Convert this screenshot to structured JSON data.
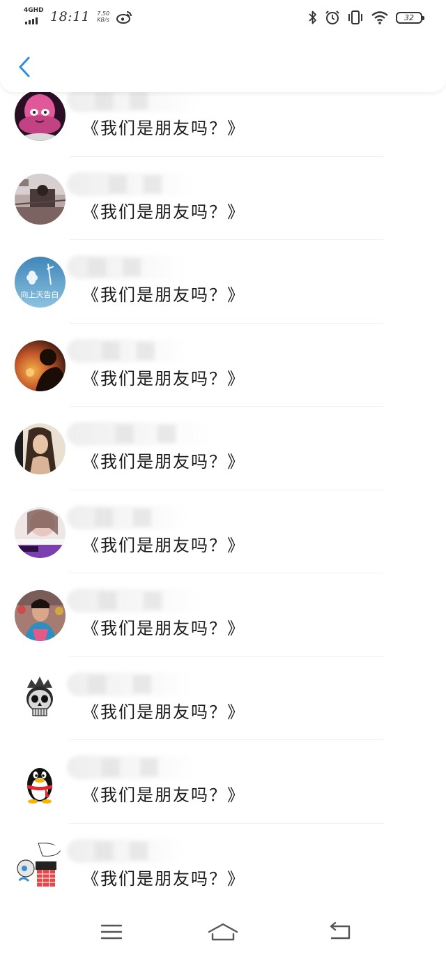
{
  "status_bar": {
    "network": "4GHD",
    "time": "18:11",
    "speed_value": "7.50",
    "speed_unit": "KB/s",
    "battery": "32",
    "icons": [
      "weibo-icon",
      "bluetooth-icon",
      "alarm-icon",
      "vibrate-icon",
      "wifi-icon",
      "battery-icon"
    ]
  },
  "header": {
    "back_icon": "chevron-left-icon",
    "accent_color": "#2f8fde"
  },
  "items": [
    {
      "title": "《我们是朋友吗？》",
      "avatar": "pink-alien-avatar"
    },
    {
      "title": "《我们是朋友吗？》",
      "avatar": "room-photo-avatar"
    },
    {
      "title": "《我们是朋友吗？》",
      "avatar": "blue-sky-avatar",
      "avatar_caption": "向上天告白"
    },
    {
      "title": "《我们是朋友吗？》",
      "avatar": "sunset-silhouette-avatar"
    },
    {
      "title": "《我们是朋友吗？》",
      "avatar": "woman-portrait-avatar"
    },
    {
      "title": "《我们是朋友吗？》",
      "avatar": "girl-purple-avatar"
    },
    {
      "title": "《我们是朋友吗？》",
      "avatar": "woman-selfie-avatar"
    },
    {
      "title": "《我们是朋友吗？》",
      "avatar": "crowned-skull-avatar"
    },
    {
      "title": "《我们是朋友吗？》",
      "avatar": "qq-penguin-avatar"
    },
    {
      "title": "《我们是朋友吗？》",
      "avatar": "cartoon-avatar"
    }
  ],
  "nav_bar": {
    "icons": [
      "menu-icon",
      "home-icon",
      "back-icon"
    ]
  }
}
